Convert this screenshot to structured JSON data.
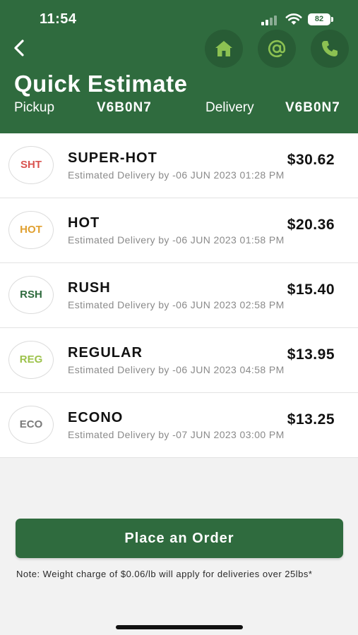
{
  "status_bar": {
    "time": "11:54",
    "battery": "82"
  },
  "header": {
    "title": "Quick Estimate",
    "pickup_label": "Pickup",
    "pickup_code": "V6B0N7",
    "delivery_label": "Delivery",
    "delivery_code": "V6B0N7"
  },
  "icons": {
    "back": "back-arrow-icon",
    "home": "home-icon",
    "email": "at-sign-icon",
    "phone": "phone-icon"
  },
  "colors": {
    "header": "#2f6b3e",
    "icon_accent": "#8cc152",
    "sht": "#d9534f",
    "hot": "#e0a030",
    "rsh": "#2f6b3e",
    "reg": "#9cc24a",
    "eco": "#7a7a7a"
  },
  "options": [
    {
      "code": "SHT",
      "name": "SUPER-HOT",
      "eta": "Estimated Delivery by -06 JUN 2023 01:28 PM",
      "price": "$30.62",
      "color": "#d9534f"
    },
    {
      "code": "HOT",
      "name": "HOT",
      "eta": "Estimated Delivery by -06 JUN 2023 01:58 PM",
      "price": "$20.36",
      "color": "#e0a030"
    },
    {
      "code": "RSH",
      "name": "RUSH",
      "eta": "Estimated Delivery by -06 JUN 2023 02:58 PM",
      "price": "$15.40",
      "color": "#2f6b3e"
    },
    {
      "code": "REG",
      "name": "REGULAR",
      "eta": "Estimated Delivery by -06 JUN 2023 04:58 PM",
      "price": "$13.95",
      "color": "#9cc24a"
    },
    {
      "code": "ECO",
      "name": "ECONO",
      "eta": "Estimated Delivery by -07 JUN 2023 03:00 PM",
      "price": "$13.25",
      "color": "#7a7a7a"
    }
  ],
  "order_button": "Place an Order",
  "note": "Note: Weight charge of $0.06/lb will apply for deliveries over 25lbs*"
}
